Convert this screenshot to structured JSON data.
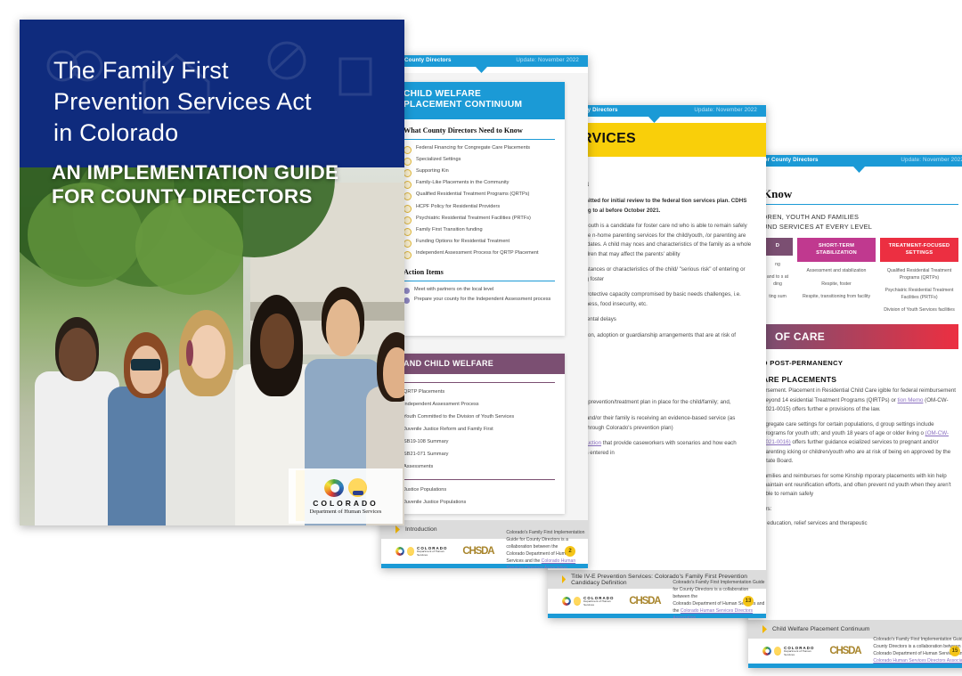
{
  "cover": {
    "title_lines": [
      "The Family First",
      "Prevention Services Act",
      "in Colorado"
    ],
    "subtitle_lines": [
      "AN IMPLEMENTATION GUIDE",
      "FOR COUNTY DIRECTORS"
    ],
    "logo": {
      "name": "COLORADO",
      "dept": "Department of Human Services"
    },
    "colors": {
      "navy": "#0f2b7d"
    }
  },
  "header": {
    "left": "e for County Directors",
    "right": "Update: November 2022",
    "color": "#1b9ad6"
  },
  "footer": {
    "note_line1": "Colorado's Family First Implementation Guide for County Directors is a collaboration between the",
    "note_line2_pre": "Colorado Department of Human Services and the ",
    "note_link": "Colorado Human Services Directors Association",
    "note_end": ".",
    "logo_name": "COLORADO",
    "logo_dept": "Department of Human Services",
    "partner": "CHSDA"
  },
  "page2": {
    "card1": {
      "title_lines": [
        "CHILD WELFARE",
        "PLACEMENT CONTINUUM"
      ],
      "section1_title": "What County Directors Need to Know",
      "items": [
        "Federal Financing for Congregate Care Placements",
        "Specialized Settings",
        "Supporting Kin",
        "Family-Like Placements in the Community",
        "Qualified Residential Treatment Programs (QRTPs)",
        "HCPF Policy for Residential Providers",
        "Psychiatric Residential Treatment Facilities (PRTFs)",
        "Family First Transition funding",
        "Funding Options for Residential Treatment",
        "Independent Assessment Process for QRTP Placement"
      ],
      "section2_title": "Action Items",
      "actions": [
        "Meet with partners on the local level",
        "Prepare your county for the Independent Assessment process"
      ]
    },
    "card2": {
      "title": "AND CHILD WELFARE",
      "items_a": [
        "QRTP Placements",
        "Independent Assessment Process",
        "Youth Committed to the Division of Youth Services",
        "Juvenile Justice Reform and Family First",
        "SB19-108 Summary",
        "SB21-071 Summary",
        "Assessments"
      ],
      "items_b": [
        "Justice Populations",
        "Juvenile Justice Populations"
      ]
    },
    "footer_tab": "Introduction",
    "page_number": "2"
  },
  "page3": {
    "banner_title": "SERVICES",
    "heading": "nition",
    "paragraphs": [
      "was submitted for initial review to the federal tion services plan. CDHS is planning to al before October 2021.",
      "s, a child/youth is a candidate for foster care nd who is able to remain safely in the home n-home parenting services for the child/youth, /or parenting are also candidates. A child may nces and characteristics of the family as a whole nts or children that may affect the parents' ability",
      "ng circumstances or characteristics of the child/ \"serious risk\" of entering or re-entering foster",
      "Parental protective capacity compromised by basic needs challenges, i.e. homelessness, food insecurity, etc.",
      "Developmental delays",
      "Reunification, adoption or guardianship arrangements that are at risk of disruption"
    ],
    "then_label": "en:",
    "conditions": [
      "There is a prevention/treatment plan in place for the child/family; and,",
      "The child and/or their family is receiving an evidence-based service (as identified through Colorado's prevention plan)"
    ],
    "closing_pre": "",
    "closing_link": "deo introduction",
    "closing_post": " that provide caseworkers with scenarios and how each scenario is entered in",
    "footer_tab": "Title IV-E Prevention Services: Colorado's Family First  Prevention Candidacy Definition",
    "page_number": "13"
  },
  "page4": {
    "heading": "Know",
    "table_caption_lines": [
      "DREN, YOUTH AND FAMILIES",
      "UND SERVICES AT EVERY LEVEL"
    ],
    "table": {
      "headers": [
        "D",
        "SHORT-TERM STABILIZATION",
        "TREATMENT-FOCUSED SETTINGS"
      ],
      "header_colors": [
        "#7b4f72",
        "#c0398f",
        "#ec2f41"
      ],
      "columns": [
        [
          "ng",
          "and to s at ding",
          "ting sum"
        ],
        [
          "Assessment and stabilization",
          "Respite, foster",
          "Respite, transitioning from facility"
        ],
        [
          "Qualified Residential Treatment Programs (QRTPs)",
          "Psychiatric Residential Treatment Facilities (PRTFs)",
          "Division of Youth Services facilities"
        ]
      ]
    },
    "band": "OF CARE",
    "subhead1": "D POST-PERMANENCY",
    "subhead2": "ARE PLACEMENTS",
    "paragraph1_pre": "ursement. Placement in Residential Child Care igible for federal reimbursement beyond 14 esidential Treatment Programs (QIRTPs) or ",
    "paragraph1_link": "tion Memo",
    "paragraph1_post": " (OM-CW-2021-0015) offers further e provisions of the law.",
    "paragraph2_pre": "ngregate care settings for certain populations, d group settings include programs for youth uth; and youth 18 years of age or older living o ",
    "paragraph2_link": "(OM-CW-2021-0016)",
    "paragraph2_post": " offers further guidance ecialized services to pregnant and/or parenting icking or children/youth who are at risk of being en approved by the State Board.",
    "paragraph3": "families and reimburses for some Kinship mporary placements with kin help maintain ent reunification efforts, and often prevent nd youth when they aren't able to remain safely",
    "paragraph4": "ers:",
    "paragraph5": "a education, relief services and therapeutic",
    "footer_tab": "Child Welfare Placement Continuum",
    "page_number": "15"
  }
}
